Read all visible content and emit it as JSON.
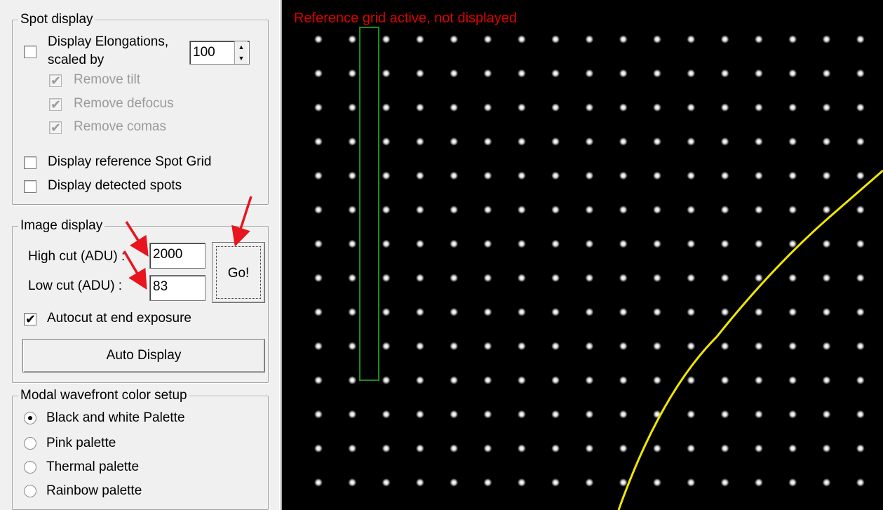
{
  "spot_display": {
    "title": "Spot display",
    "display_elongations_label_line1": "Display Elongations,",
    "display_elongations_label_line2": "scaled by",
    "scale_value": "100",
    "remove_tilt_label": "Remove tilt",
    "remove_defocus_label": "Remove defocus",
    "remove_comas_label": "Remove comas",
    "reference_grid_label": "Display reference Spot Grid",
    "detected_spots_label": "Display detected spots"
  },
  "image_display": {
    "title": "Image display",
    "high_cut_label": "High cut (ADU) :",
    "high_cut_value": "2000",
    "low_cut_label": "Low cut (ADU) :",
    "low_cut_value": "83",
    "go_button": "Go!",
    "autocut_label": "Autocut at end exposure",
    "auto_display_button": "Auto Display"
  },
  "modal_wavefront": {
    "title": "Modal wavefront color setup",
    "options": [
      "Black and white Palette",
      "Pink palette",
      "Thermal palette",
      "Rainbow palette"
    ],
    "selected": "Black and white Palette"
  },
  "image_view": {
    "status_text": "Reference grid active, not displayed",
    "grid_columns": 17,
    "grid_rows": 14
  },
  "colors": {
    "status_text": "#e00000",
    "annotation_arrow": "#e8141e",
    "roi_rectangle": "#1e8c1e",
    "curve": "#f0e600",
    "spot": "#ffffff",
    "background": "#000000"
  },
  "icons": {
    "checkmark": "✔",
    "spin_up": "▲",
    "spin_down": "▼"
  }
}
